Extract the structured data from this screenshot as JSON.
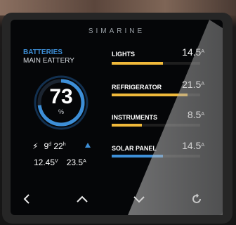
{
  "device": {
    "brand": "SIMARINE"
  },
  "battery": {
    "title": "BATTERIES",
    "name": "MAIN EATTERY",
    "percent": "73",
    "percent_unit": "%",
    "level_fraction": 0.73,
    "time_days": "9",
    "time_days_unit": "d",
    "time_hours": "22",
    "time_hours_unit": "h",
    "voltage": "12.45",
    "voltage_unit": "V",
    "current": "23.5",
    "current_unit": "A",
    "trend_icon": "up-arrow-icon",
    "charge_icon": "lightning-bolt-icon"
  },
  "channels": [
    {
      "label": "LIGHTS",
      "value": "14.5",
      "unit": "A",
      "fill_fraction": 0.58,
      "color": "#f0b93a"
    },
    {
      "label": "REFRIGERATOR",
      "value": "21.5",
      "unit": "A",
      "fill_fraction": 0.86,
      "color": "#f0b93a"
    },
    {
      "label": "INSTRUMENTS",
      "value": "8.5",
      "unit": "A",
      "fill_fraction": 0.34,
      "color": "#f0b93a"
    },
    {
      "label": "SOLAR PANEL",
      "value": "14.5",
      "unit": "A",
      "fill_fraction": 0.58,
      "color": "#3d8fd8"
    }
  ],
  "nav": [
    "back-icon",
    "up-chevron-icon",
    "down-chevron-icon",
    "refresh-icon"
  ],
  "colors": {
    "accent_blue": "#3d8fd8",
    "bar_amber": "#f0b93a",
    "screen_bg": "#050608"
  }
}
